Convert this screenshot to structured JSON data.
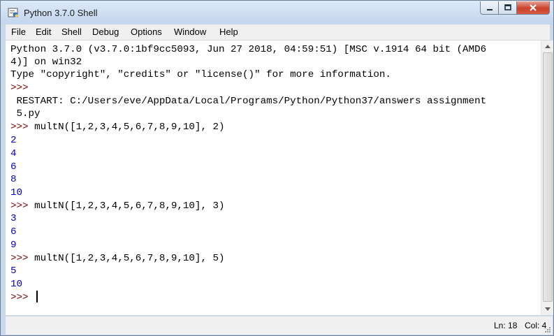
{
  "window": {
    "title": "Python 3.7.0 Shell"
  },
  "menu": [
    "File",
    "Edit",
    "Shell",
    "Debug",
    "Options",
    "Window",
    "Help"
  ],
  "shell": {
    "lines": [
      {
        "kind": "out",
        "text": "Python 3.7.0 (v3.7.0:1bf9cc5093, Jun 27 2018, 04:59:51) [MSC v.1914 64 bit (AMD6"
      },
      {
        "kind": "out",
        "text": "4)] on win32"
      },
      {
        "kind": "out",
        "text": "Type \"copyright\", \"credits\" or \"license()\" for more information."
      },
      {
        "kind": "prompt",
        "text": ">>> "
      },
      {
        "kind": "out",
        "text": " RESTART: C:/Users/eve/AppData/Local/Programs/Python/Python37/answers assignment"
      },
      {
        "kind": "out",
        "text": " 5.py"
      },
      {
        "kind": "prompt",
        "text": ">>> multN([1,2,3,4,5,6,7,8,9,10], 2)"
      },
      {
        "kind": "num",
        "text": "2"
      },
      {
        "kind": "num",
        "text": "4"
      },
      {
        "kind": "num",
        "text": "6"
      },
      {
        "kind": "num",
        "text": "8"
      },
      {
        "kind": "num",
        "text": "10"
      },
      {
        "kind": "prompt",
        "text": ">>> multN([1,2,3,4,5,6,7,8,9,10], 3)"
      },
      {
        "kind": "num",
        "text": "3"
      },
      {
        "kind": "num",
        "text": "6"
      },
      {
        "kind": "num",
        "text": "9"
      },
      {
        "kind": "prompt",
        "text": ">>> multN([1,2,3,4,5,6,7,8,9,10], 5)"
      },
      {
        "kind": "num",
        "text": "5"
      },
      {
        "kind": "num",
        "text": "10"
      },
      {
        "kind": "prompt",
        "text": ">>> "
      }
    ]
  },
  "status": {
    "line": "Ln: 18",
    "col": "Col: 4"
  },
  "icons": {
    "app": "python-idle-icon",
    "minimize": "minimize-icon",
    "maximize": "maximize-icon",
    "close": "close-icon"
  },
  "colors": {
    "prompt": "#7f0000",
    "output_number": "#0000c0",
    "stdout": "#000000"
  }
}
